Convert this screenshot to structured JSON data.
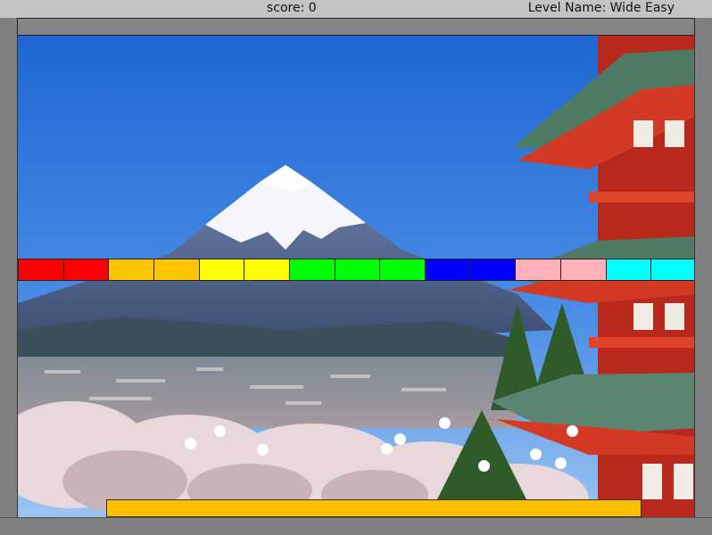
{
  "hud": {
    "score_text": "score: 0",
    "level_text": "Level Name: Wide Easy"
  },
  "game": {
    "score": 0,
    "level_name": "Wide Easy",
    "block_row": {
      "colors": [
        "#ff0000",
        "#ff0000",
        "#ffc400",
        "#ffc400",
        "#ffff00",
        "#ffff00",
        "#00ff00",
        "#00ff00",
        "#00ff00",
        "#0000ff",
        "#0000ff",
        "#ffb0b8",
        "#ffb0b8",
        "#00ffff",
        "#00ffff"
      ]
    },
    "ball_color": "#ffffff",
    "paddle_color": "#fdbe00",
    "background": "mount-fuji-pagoda-cherry-blossom"
  }
}
